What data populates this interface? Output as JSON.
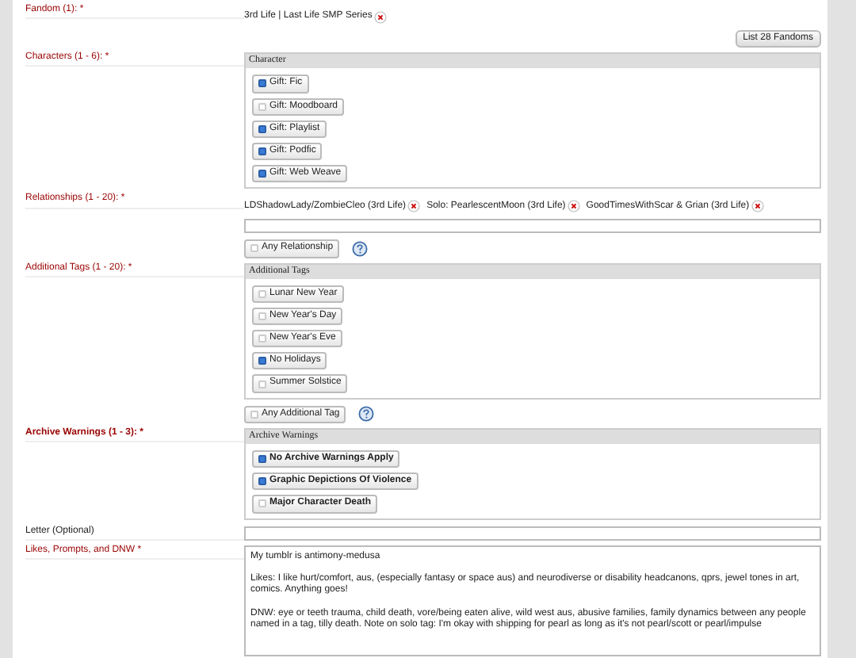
{
  "sections": [
    {
      "kind": "fandom",
      "label": "Fandom (1): *",
      "required": true,
      "tags": [
        "3rd Life | Last Life SMP Series"
      ],
      "button": "List 28 Fandoms"
    },
    {
      "kind": "checklist",
      "label": "Characters (1 - 6): *",
      "required": true,
      "legend": "Character",
      "options": [
        {
          "label": "Gift: Fic",
          "checked": true
        },
        {
          "label": "Gift: Moodboard",
          "checked": false
        },
        {
          "label": "Gift: Playlist",
          "checked": true
        },
        {
          "label": "Gift: Podfic",
          "checked": true
        },
        {
          "label": "Gift: Web Weave",
          "checked": true
        }
      ]
    },
    {
      "kind": "tags",
      "label": "Relationships (1 - 20): *",
      "required": true,
      "tags": [
        "LDShadowLady/ZombieCleo (3rd Life)",
        "Solo: PearlescentMoon (3rd Life)",
        "GoodTimesWithScar & Grian (3rd Life)"
      ],
      "any": {
        "label": "Any Relationship",
        "checked": false
      }
    },
    {
      "kind": "checklist",
      "label": "Additional Tags (1 - 20): *",
      "required": true,
      "legend": "Additional Tags",
      "options": [
        {
          "label": "Lunar New Year",
          "checked": false
        },
        {
          "label": "New Year's Day",
          "checked": false
        },
        {
          "label": "New Year's Eve",
          "checked": false
        },
        {
          "label": "No Holidays",
          "checked": true
        },
        {
          "label": "Summer Solstice",
          "checked": false
        }
      ],
      "any": {
        "label": "Any Additional Tag",
        "checked": false
      }
    },
    {
      "kind": "checklist",
      "label": "Archive Warnings (1 - 3): *",
      "required": true,
      "bold": true,
      "legend": "Archive Warnings",
      "options": [
        {
          "label": "No Archive Warnings Apply",
          "checked": true
        },
        {
          "label": "Graphic Depictions Of Violence",
          "checked": true
        },
        {
          "label": "Major Character Death",
          "checked": false
        }
      ]
    },
    {
      "kind": "text",
      "label": "Letter (Optional)",
      "required": false
    },
    {
      "kind": "textarea",
      "label": "Likes, Prompts, and DNW *",
      "required": true,
      "value": "My tumblr is antimony-medusa\n\nLikes: I like hurt/comfort, aus, (especially fantasy or space aus) and neurodiverse or disability headcanons, qprs, jewel tones in art, comics. Anything goes!\n\nDNW: eye or teeth trauma, child death, vore/being eaten alive, wild west aus, abusive families, family dynamics between any people named in a tag, tilly death. Note on solo tag: I'm okay with shipping for pearl as long as it's not pearl/scott or pearl/impulse"
    }
  ]
}
